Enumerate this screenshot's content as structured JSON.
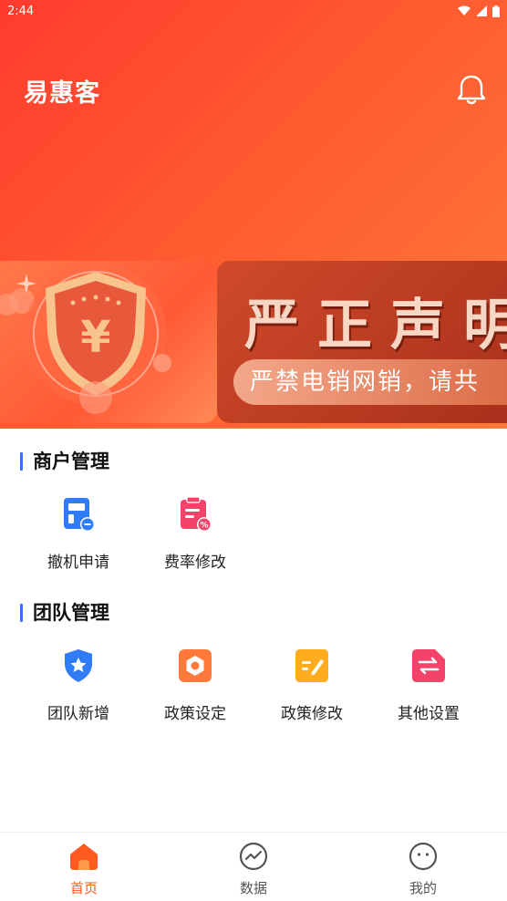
{
  "status_bar": {
    "time": "2:44"
  },
  "header": {
    "title": "易惠客"
  },
  "banner": {
    "heading": "严正声明",
    "subtext": "严禁电销网销，请共",
    "coin_symbol": "¥"
  },
  "sections": [
    {
      "title": "商户管理",
      "items": [
        {
          "label": "撤机申请",
          "icon": "calculator-icon",
          "color": "#2f7cf6"
        },
        {
          "label": "费率修改",
          "icon": "clipboard-percent-icon",
          "color": "#f4436a"
        }
      ]
    },
    {
      "title": "团队管理",
      "items": [
        {
          "label": "团队新增",
          "icon": "shield-star-icon",
          "color": "#2f7cf6"
        },
        {
          "label": "政策设定",
          "icon": "hexagon-settings-icon",
          "color": "#ff7a3a"
        },
        {
          "label": "政策修改",
          "icon": "edit-doc-icon",
          "color": "#ffad1f"
        },
        {
          "label": "其他设置",
          "icon": "swap-doc-icon",
          "color": "#f4436a"
        }
      ]
    }
  ],
  "bottom_nav": [
    {
      "label": "首页",
      "icon": "home-icon",
      "active": true
    },
    {
      "label": "数据",
      "icon": "chart-circle-icon",
      "active": false
    },
    {
      "label": "我的",
      "icon": "face-circle-icon",
      "active": false
    }
  ],
  "colors": {
    "accent": "#ff5a1f",
    "section_bar": "#3b6ef6"
  }
}
